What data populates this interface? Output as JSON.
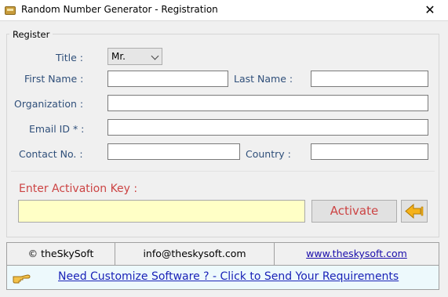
{
  "window": {
    "title": "Random Number Generator - Registration",
    "close_glyph": "✕"
  },
  "register": {
    "legend": "Register",
    "title_label": "Title :",
    "title_value": "Mr.",
    "first_name_label": "First Name :",
    "last_name_label": "Last Name :",
    "organization_label": "Organization :",
    "email_label": "Email ID * :",
    "contact_label": "Contact No. :",
    "country_label": "Country :",
    "first_name_value": "",
    "last_name_value": "",
    "organization_value": "",
    "email_value": "",
    "contact_value": "",
    "country_value": ""
  },
  "activation": {
    "label": "Enter Activation Key  :",
    "key_value": "",
    "button_label": "Activate"
  },
  "footer": {
    "copyright": "© theSkySoft",
    "email": "info@theskysoft.com",
    "website": "www.theskysoft.com",
    "banner_text": "Need Customize Software ? - Click to Send Your Requirements"
  },
  "icons": {
    "app": "app-icon",
    "back": "arrow-left-icon",
    "hand": "pointing-hand-icon"
  },
  "colors": {
    "accent_red": "#cc4444",
    "label_blue": "#2f4f7a",
    "link_blue": "#1a0dab",
    "key_field": "#ffffc6"
  }
}
